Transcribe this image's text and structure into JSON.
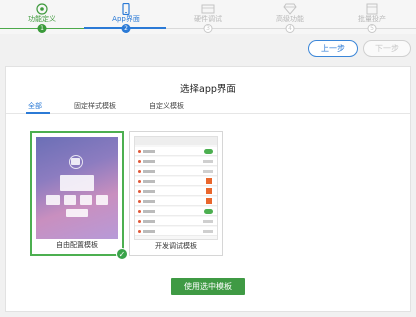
{
  "stepper": {
    "steps": [
      {
        "label": "功能定义",
        "number": "1",
        "state": "done",
        "icon": "function-icon"
      },
      {
        "label": "App界面",
        "number": "2",
        "state": "active",
        "icon": "phone-icon"
      },
      {
        "label": "硬件调试",
        "number": "3",
        "state": "todo",
        "icon": "hardware-icon"
      },
      {
        "label": "高级功能",
        "number": "4",
        "state": "todo",
        "icon": "diamond-icon"
      },
      {
        "label": "批量投产",
        "number": "5",
        "state": "todo",
        "icon": "factory-icon"
      }
    ]
  },
  "nav": {
    "prev_label": "上一步",
    "next_label": "下一步"
  },
  "panel": {
    "title": "选择app界面",
    "tabs": [
      "全部",
      "固定样式模板",
      "自定义模板"
    ],
    "active_tab": "全部"
  },
  "templates": [
    {
      "label": "自由配置模板",
      "selected": true
    },
    {
      "label": "开发调试模板",
      "selected": false
    }
  ],
  "actions": {
    "use_selected_label": "使用选中模板"
  },
  "colors": {
    "primary": "#2b7ad6",
    "success": "#3f9a44",
    "disabled": "#c8c8c8"
  }
}
